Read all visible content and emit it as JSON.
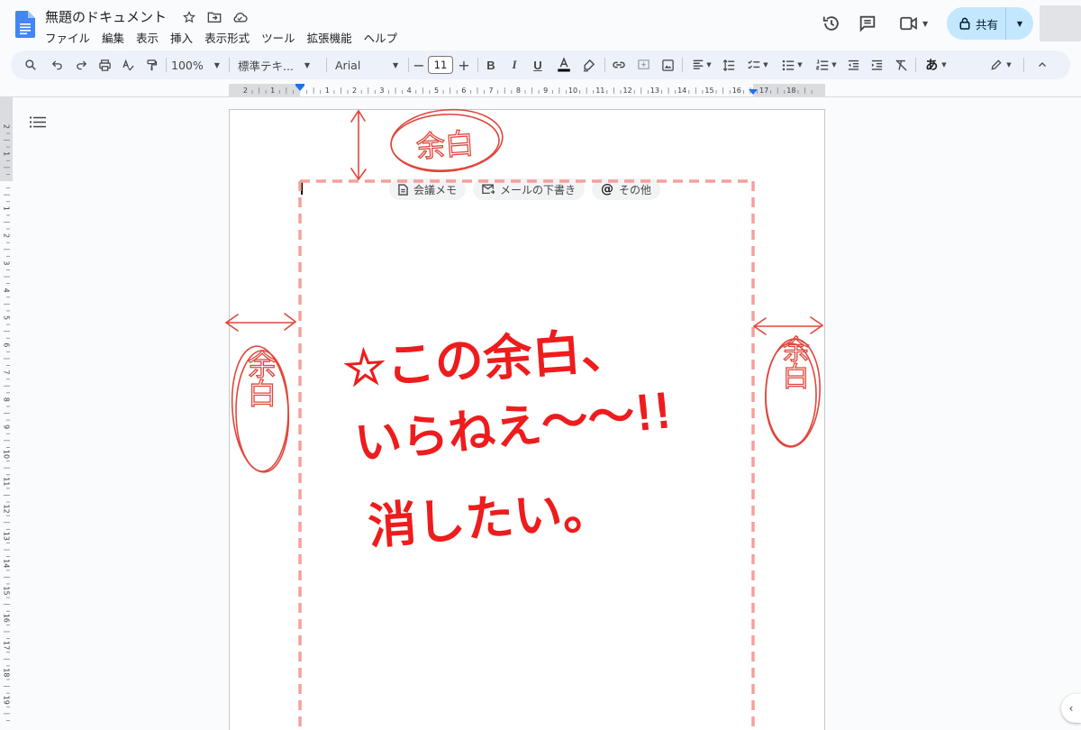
{
  "document": {
    "title": "無題のドキュメント"
  },
  "menu": {
    "items": [
      "ファイル",
      "編集",
      "表示",
      "挿入",
      "表示形式",
      "ツール",
      "拡張機能",
      "ヘルプ"
    ]
  },
  "header": {
    "share_label": "共有"
  },
  "toolbar": {
    "zoom": "100%",
    "style": "標準テキ...",
    "font": "Arial",
    "font_size": "11",
    "input_tool": "あ"
  },
  "chips": {
    "meeting_notes": "会議メモ",
    "email_draft": "メールの下書き",
    "other": "その他"
  },
  "ruler": {
    "h_labels": [
      "2",
      "1",
      "",
      "1",
      "2",
      "3",
      "4",
      "5",
      "6",
      "7",
      "8",
      "9",
      "10",
      "11",
      "12",
      "13",
      "14",
      "15",
      "16",
      "17",
      "18"
    ],
    "v_labels": [
      "2",
      "1",
      "",
      "1",
      "2",
      "3",
      "4",
      "5",
      "6",
      "7",
      "8",
      "9",
      "10",
      "11",
      "12",
      "13",
      "14",
      "15",
      "16",
      "17",
      "18",
      "19"
    ]
  },
  "annotation": {
    "margin_label": "余白",
    "line1": "☆この余白、",
    "line2": "いらねえ〜〜!!",
    "line3": "消したい。",
    "pen_color": "#ee1c1c",
    "pencil_color": "#e0473c",
    "dash_color": "#f5a09a"
  },
  "colors": {
    "accent": "#0b57d0",
    "share_bg": "#c2e7ff",
    "toolbar_bg": "#edf2fa"
  }
}
